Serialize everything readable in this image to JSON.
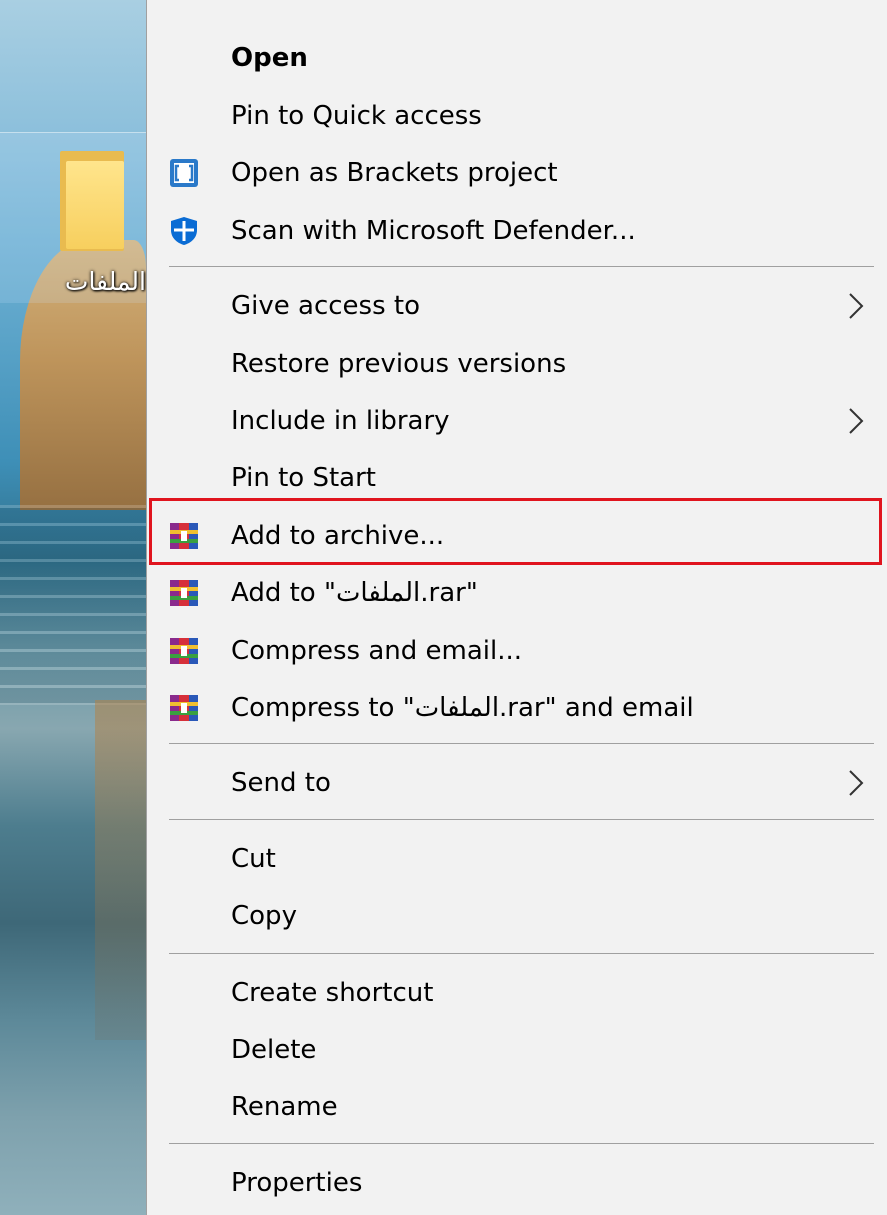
{
  "desktop": {
    "folder_label": "الملفات"
  },
  "menu": {
    "items": [
      {
        "label": "Open",
        "icon": "",
        "submenu": false,
        "bold": true
      },
      {
        "label": "Pin to Quick access",
        "icon": "",
        "submenu": false
      },
      {
        "label": "Open as Brackets project",
        "icon": "brackets-icon",
        "submenu": false
      },
      {
        "label": "Scan with Microsoft Defender...",
        "icon": "defender-shield-icon",
        "submenu": false
      },
      {
        "label": "Give access to",
        "icon": "",
        "submenu": true
      },
      {
        "label": "Restore previous versions",
        "icon": "",
        "submenu": false
      },
      {
        "label": "Include in library",
        "icon": "",
        "submenu": true
      },
      {
        "label": "Pin to Start",
        "icon": "",
        "submenu": false
      },
      {
        "label": "Add to archive...",
        "icon": "winrar-icon",
        "submenu": false,
        "highlighted": true
      },
      {
        "label": "Add to \"الملفات.rar\"",
        "icon": "winrar-icon",
        "submenu": false
      },
      {
        "label": "Compress and email...",
        "icon": "winrar-icon",
        "submenu": false
      },
      {
        "label": "Compress to \"الملفات.rar\" and email",
        "icon": "winrar-icon",
        "submenu": false
      },
      {
        "label": "Send to",
        "icon": "",
        "submenu": true
      },
      {
        "label": "Cut",
        "icon": "",
        "submenu": false
      },
      {
        "label": "Copy",
        "icon": "",
        "submenu": false
      },
      {
        "label": "Create shortcut",
        "icon": "",
        "submenu": false
      },
      {
        "label": "Delete",
        "icon": "",
        "submenu": false
      },
      {
        "label": "Rename",
        "icon": "",
        "submenu": false
      },
      {
        "label": "Properties",
        "icon": "",
        "submenu": false
      }
    ]
  },
  "colors": {
    "menu_background": "#f2f2f2",
    "separator": "#a0a0a0",
    "highlight_border": "#e0141e",
    "brackets_blue": "#2a79c9",
    "defender_blue": "#0a6cd4"
  }
}
